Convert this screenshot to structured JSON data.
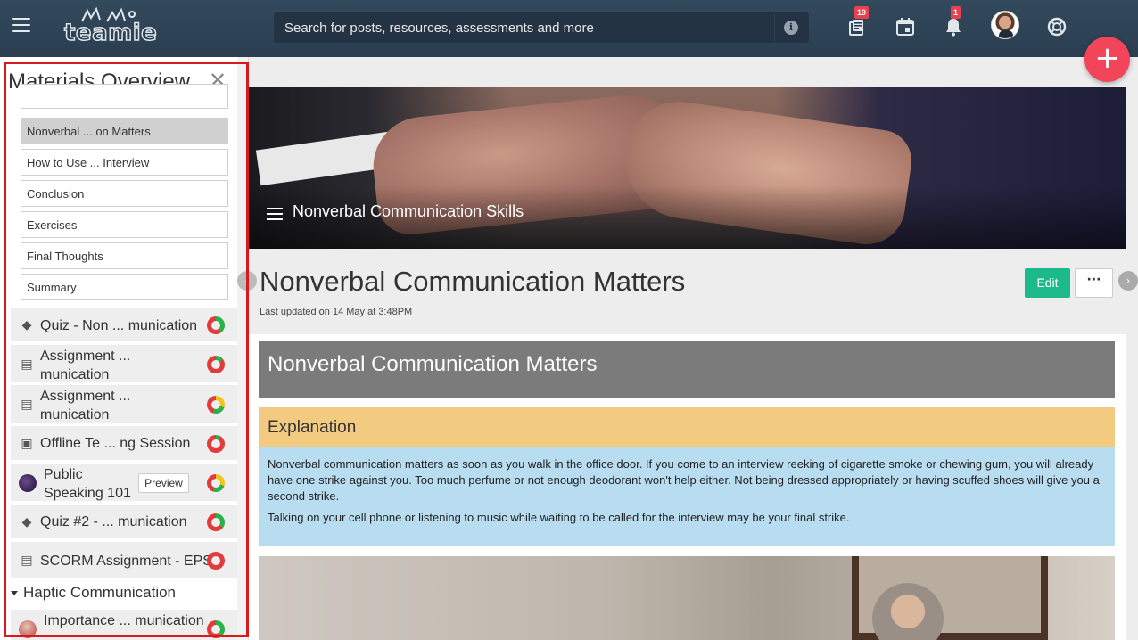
{
  "topbar": {
    "logo_text": "teamie",
    "search_placeholder": "Search for posts, resources, assessments and more",
    "posts_badge": "19",
    "notifications_badge": "1",
    "fab_label": "+"
  },
  "sidebar": {
    "title": "Materials Overview",
    "close": "✕",
    "pages": [
      {
        "label": "Nonverbal ... on Matters",
        "active": true
      },
      {
        "label": "How to Use ... Interview"
      },
      {
        "label": "Conclusion"
      },
      {
        "label": "Exercises"
      },
      {
        "label": "Final Thoughts"
      },
      {
        "label": "Summary"
      }
    ],
    "items": [
      {
        "label": "Quiz - Non ... munication",
        "icon": "quiz-icon"
      },
      {
        "label": "Assignment ... munication",
        "icon": "assignment-icon"
      },
      {
        "label": "Assignment ... munication",
        "icon": "assignment-icon"
      },
      {
        "label": "Offline Te ... ng Session",
        "icon": "offline-test-icon"
      },
      {
        "label": "Public Speaking 101",
        "icon": "lesson-thumbnail-icon",
        "preview": "Preview"
      },
      {
        "label": "Quiz #2 - ... munication",
        "icon": "quiz-icon"
      },
      {
        "label": "SCORM Assignment - EPS",
        "icon": "assignment-icon"
      }
    ],
    "section": "Haptic Communication",
    "section_item": "Importance ... munication"
  },
  "main": {
    "hero_title": "Nonverbal Communication Skills",
    "page_title": "Nonverbal Communication Matters",
    "last_updated": "Last updated on 14 May at 3:48PM",
    "edit_label": "Edit",
    "more_label": "···",
    "banner_title": "Nonverbal Communication Matters",
    "explanation_heading": "Explanation",
    "explanation_p1": "Nonverbal communication matters as soon as you walk in the office door. If you come to an interview reeking of cigarette smoke or chewing gum, you will already have one strike against you. Too much perfume or not enough deodorant won't help either. Not being dressed appropriately or having scuffed shoes will give you a second strike.",
    "explanation_p2": "Talking on your cell phone or listening to music while waiting to be called for the interview may be your final strike."
  },
  "colors": {
    "topbar": "#2b3e51",
    "accent_green": "#1cba8a",
    "fab_red": "#f2455a",
    "explanation_header": "#f3cb80",
    "explanation_body": "#b8ddf1",
    "highlight_border": "#d9191c"
  }
}
